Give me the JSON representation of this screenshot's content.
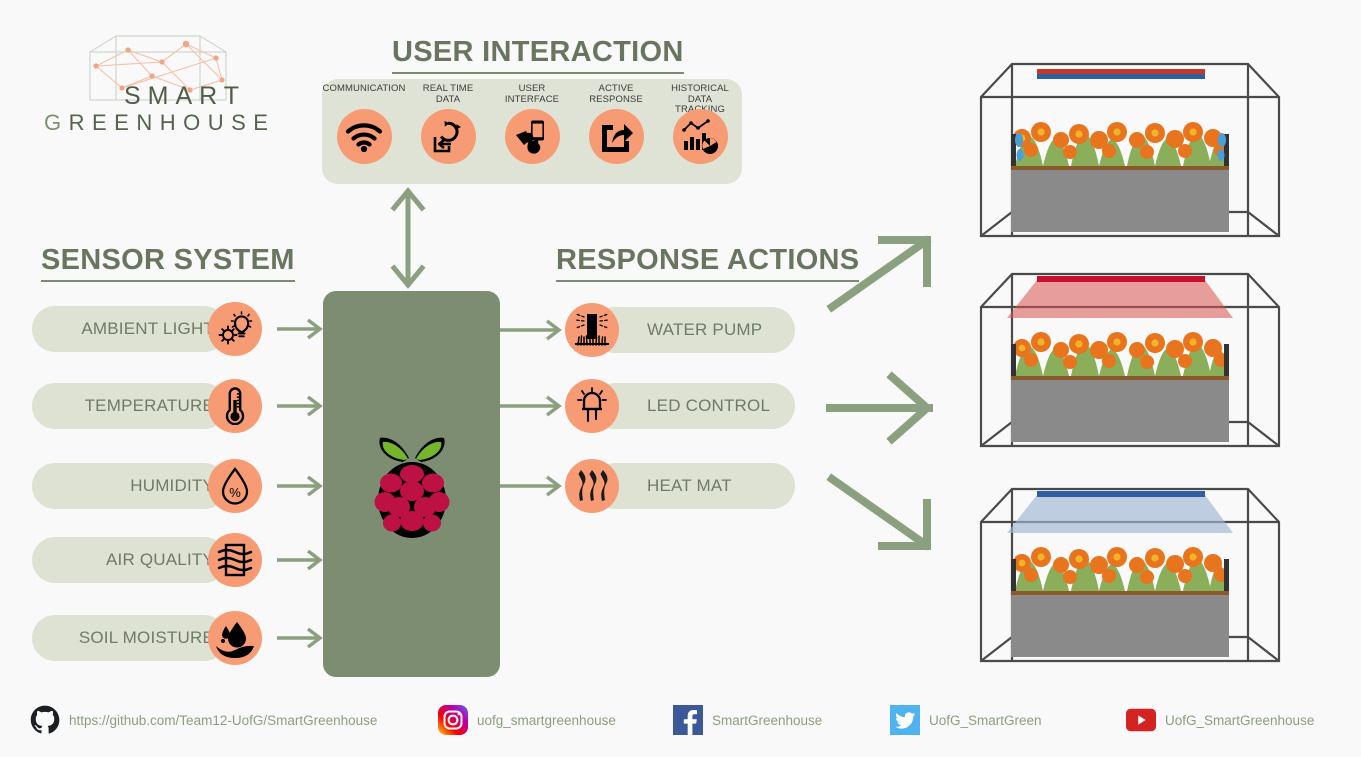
{
  "logo": {
    "line1": "SMART",
    "line2_first": "G",
    "line2_rest": "REENHOUSE",
    "icon": "greenhouse-wireframe-logo"
  },
  "headings": {
    "user_interaction": "USER INTERACTION",
    "sensor_system": "SENSOR SYSTEM",
    "response_actions": "RESPONSE ACTIONS"
  },
  "user_interaction": {
    "items": [
      {
        "label": "COMMUNICATION",
        "icon": "wifi-icon"
      },
      {
        "label": "REAL TIME\nDATA",
        "label_l1": "REAL TIME",
        "label_l2": "DATA",
        "icon": "sync-login-icon"
      },
      {
        "label": "USER\nINTERFACE",
        "label_l1": "USER",
        "label_l2": "INTERFACE",
        "icon": "hand-phone-touch-icon"
      },
      {
        "label": "ACTIVE\nRESPONSE",
        "label_l1": "ACTIVE",
        "label_l2": "RESPONSE",
        "icon": "share-arrow-icon"
      },
      {
        "label": "HISTORICAL DATA\nTRACKING",
        "label_l1": "HISTORICAL DATA",
        "label_l2": "TRACKING",
        "icon": "analytics-chart-icon"
      }
    ]
  },
  "sensors": [
    {
      "label": "AMBIENT LIGHT",
      "icon": "sun-bulb-icon"
    },
    {
      "label": "TEMPERATURE",
      "icon": "thermometer-icon"
    },
    {
      "label": "HUMIDITY",
      "icon": "water-drop-percent-icon"
    },
    {
      "label": "AIR QUALITY",
      "icon": "air-filter-icon"
    },
    {
      "label": "SOIL MOISTURE",
      "icon": "soil-droplet-icon"
    }
  ],
  "responses": [
    {
      "label": "WATER PUMP",
      "icon": "water-pump-icon"
    },
    {
      "label": "LED CONTROL",
      "icon": "led-bulb-icon"
    },
    {
      "label": "HEAT MAT",
      "icon": "heat-waves-icon"
    }
  ],
  "controller": {
    "icon": "raspberry-pi-logo"
  },
  "flow_arrows": {
    "bidirectional": "double-arrow-vertical-icon",
    "to_greenhouse": [
      "arrow-up-right-icon",
      "arrow-right-icon",
      "arrow-down-right-icon"
    ]
  },
  "greenhouses": [
    {
      "name": "greenhouse-water-spray",
      "beam": "none",
      "strip_colors": [
        "#c0392b",
        "#2e5f9e"
      ],
      "effect": "water-droplets"
    },
    {
      "name": "greenhouse-red-led",
      "beam": "#d9534f",
      "strip_colors": [
        "#c8102e"
      ],
      "effect": "red-light-beam"
    },
    {
      "name": "greenhouse-blue-heat",
      "beam": "#9fb6d4",
      "strip_colors": [
        "#2e5f9e"
      ],
      "effect": "blue-light-beam"
    }
  ],
  "footer": {
    "links": [
      {
        "icon": "github-icon",
        "text": "https://github.com/Team12-UofG/SmartGreenhouse"
      },
      {
        "icon": "instagram-icon",
        "text": "uofg_smartgreenhouse"
      },
      {
        "icon": "facebook-icon",
        "text": "SmartGreenhouse"
      },
      {
        "icon": "twitter-icon",
        "text": "UofG_SmartGreen"
      },
      {
        "icon": "youtube-icon",
        "text": "UofG_SmartGreenhouse"
      }
    ]
  },
  "colors": {
    "background": "#f8f9f8",
    "accent_orange": "#f79b74",
    "panel_green": "#dfe3d5",
    "controller_green": "#7d8d72",
    "heading_green": "#68765f",
    "arrow_green": "#8ba07e",
    "footer_text": "#8ba07e"
  }
}
